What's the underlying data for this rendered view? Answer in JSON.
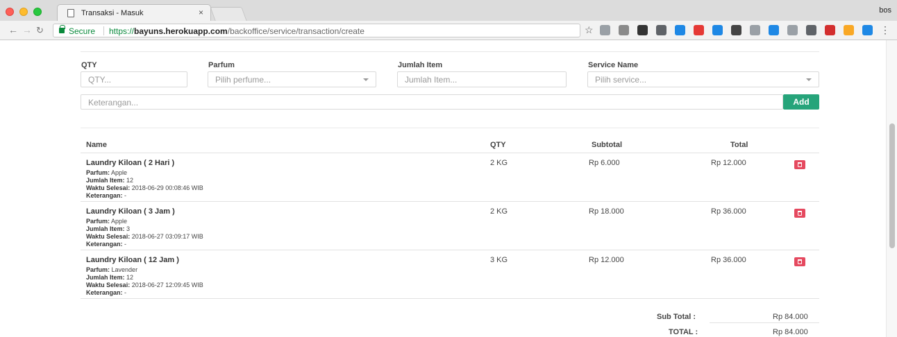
{
  "browser": {
    "tab_title": "Transaksi - Masuk",
    "tab_close": "×",
    "profile": "bos",
    "secure": "Secure",
    "url_scheme": "https://",
    "url_host": "bayuns.herokuapp.com",
    "url_path": "/backoffice/service/transaction/create",
    "extensions": [
      "#9aa0a6",
      "#8a8a8a",
      "#333333",
      "#5f6368",
      "#1e88e5",
      "#e53935",
      "#1e88e5",
      "#444444",
      "#9aa0a6",
      "#1e88e5",
      "#9aa0a6",
      "#5f6368",
      "#d32f2f",
      "#f9a825",
      "#1e88e5"
    ]
  },
  "form": {
    "qty_label": "QTY",
    "qty_placeholder": "QTY...",
    "parfum_label": "Parfum",
    "parfum_placeholder": "Pilih perfume...",
    "jumlah_label": "Jumlah Item",
    "jumlah_placeholder": "Jumlah Item...",
    "service_label": "Service Name",
    "service_placeholder": "Pilih service...",
    "keterangan_placeholder": "Keterangan...",
    "add_label": "Add"
  },
  "table": {
    "headers": {
      "name": "Name",
      "qty": "QTY",
      "subtotal": "Subtotal",
      "total": "Total"
    },
    "detail_labels": {
      "parfum": "Parfum:",
      "jumlah": "Jumlah Item:",
      "waktu": "Waktu Selesai:",
      "keterangan": "Keterangan:"
    },
    "rows": [
      {
        "name": "Laundry Kiloan ( 2 Hari )",
        "parfum": "Apple",
        "jumlah": "12",
        "waktu": "2018-06-29 00:08:46 WIB",
        "keterangan": "-",
        "qty": "2 KG",
        "subtotal": "Rp 6.000",
        "total": "Rp 12.000"
      },
      {
        "name": "Laundry Kiloan ( 3 Jam )",
        "parfum": "Apple",
        "jumlah": "3",
        "waktu": "2018-06-27 03:09:17 WIB",
        "keterangan": "-",
        "qty": "2 KG",
        "subtotal": "Rp 18.000",
        "total": "Rp 36.000"
      },
      {
        "name": "Laundry Kiloan ( 12 Jam )",
        "parfum": "Lavender",
        "jumlah": "12",
        "waktu": "2018-06-27 12:09:45 WIB",
        "keterangan": "-",
        "qty": "3 KG",
        "subtotal": "Rp 12.000",
        "total": "Rp 36.000"
      }
    ]
  },
  "summary": {
    "subtotal_label": "Sub Total :",
    "subtotal_value": "Rp 84.000",
    "total_label": "TOTAL :",
    "total_value": "Rp 84.000"
  },
  "colors": {
    "accent": "#26a47a",
    "danger": "#e5495f",
    "secure": "#0a8a3c"
  }
}
